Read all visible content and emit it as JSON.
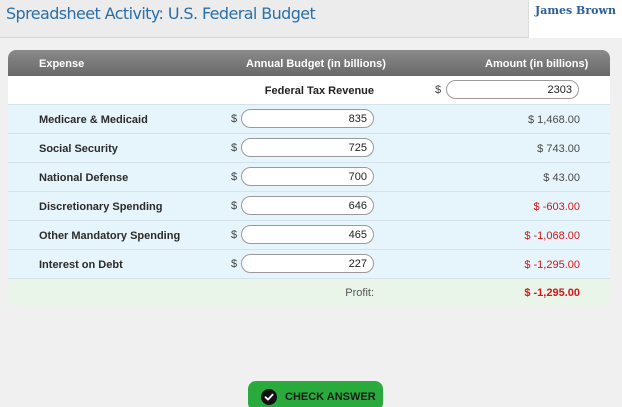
{
  "header": {
    "title": "Spreadsheet Activity: U.S. Federal Budget",
    "user_name": "James Brown"
  },
  "table": {
    "headers": {
      "expense": "Expense",
      "budget": "Annual Budget (in billions)",
      "amount": "Amount (in billions)"
    },
    "revenue": {
      "label": "Federal Tax Revenue",
      "currency": "$",
      "value": "2303"
    },
    "rows": [
      {
        "label": "Medicare & Medicaid",
        "currency": "$",
        "value": "835",
        "amount": "$ 1,468.00"
      },
      {
        "label": "Social Security",
        "currency": "$",
        "value": "725",
        "amount": "$ 743.00"
      },
      {
        "label": "National Defense",
        "currency": "$",
        "value": "700",
        "amount": "$ 43.00"
      },
      {
        "label": "Discretionary Spending",
        "currency": "$",
        "value": "646",
        "amount": "$ -603.00"
      },
      {
        "label": "Other Mandatory Spending",
        "currency": "$",
        "value": "465",
        "amount": "$ -1,068.00"
      },
      {
        "label": "Interest on Debt",
        "currency": "$",
        "value": "227",
        "amount": "$ -1,295.00"
      }
    ],
    "profit": {
      "label": "Profit:",
      "value": "$ -1,295.00"
    }
  },
  "actions": {
    "check_answer": "CHECK ANSWER",
    "check_icon": "check-circle-icon"
  },
  "colors": {
    "title": "#2a6fa8",
    "header_bar": "#757575",
    "expense_row": "#e6f4fb",
    "profit_row": "#e9f5e9",
    "negative": "#d01818",
    "button": "#2aaa3c"
  }
}
